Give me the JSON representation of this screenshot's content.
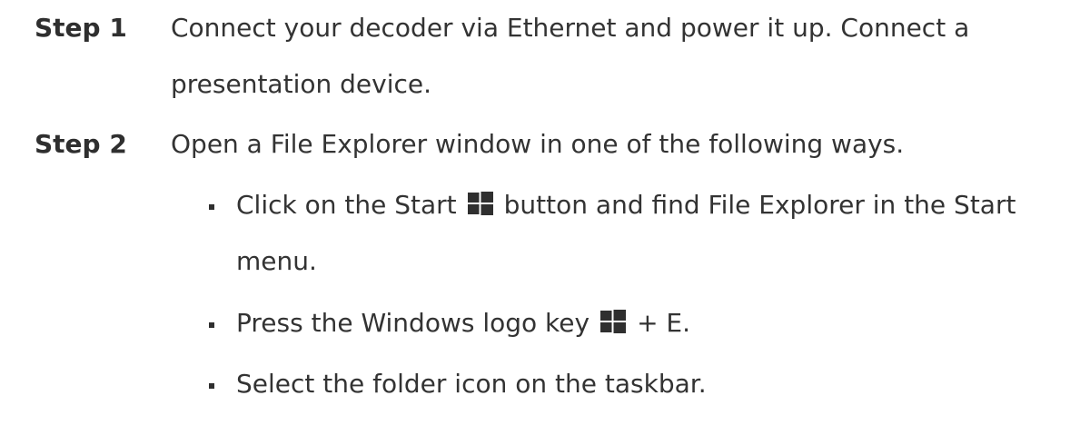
{
  "steps": [
    {
      "label": "Step 1",
      "text": "Connect your decoder via Ethernet and power it up. Connect a presentation device."
    },
    {
      "label": "Step 2",
      "text": "Open a File Explorer window in one of the following ways."
    }
  ],
  "bullets": [
    {
      "before": "Click on the Start",
      "icon": "windows-logo-icon",
      "after": "button and find File Explorer in the Start menu."
    },
    {
      "before": "Press the Windows logo key",
      "icon": "windows-logo-icon",
      "after": "+ E."
    },
    {
      "text": "Select the folder icon on the taskbar."
    }
  ]
}
